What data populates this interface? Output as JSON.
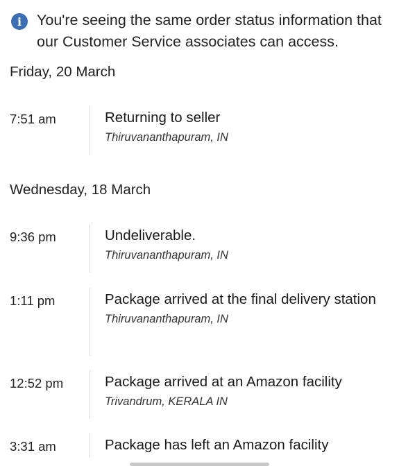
{
  "notice": {
    "icon": "info-icon",
    "text": "You're seeing the same order status information that our Customer Service associates can access."
  },
  "days": [
    {
      "label": "Friday, 20 March",
      "events": [
        {
          "time": "7:51 am",
          "status": "Returning to seller",
          "location": "Thiruvananthapuram, IN"
        }
      ]
    },
    {
      "label": "Wednesday, 18 March",
      "events": [
        {
          "time": "9:36 pm",
          "status": "Undeliverable.",
          "location": "Thiruvananthapuram, IN"
        },
        {
          "time": "1:11 pm",
          "status": "Package arrived at the final delivery station",
          "location": "Thiruvananthapuram, IN"
        },
        {
          "time": "12:52 pm",
          "status": "Package arrived at an Amazon facility",
          "location": "Trivandrum, KERALA IN"
        },
        {
          "time": "3:31 am",
          "status": "Package has left an Amazon facility",
          "location": ""
        }
      ]
    }
  ]
}
